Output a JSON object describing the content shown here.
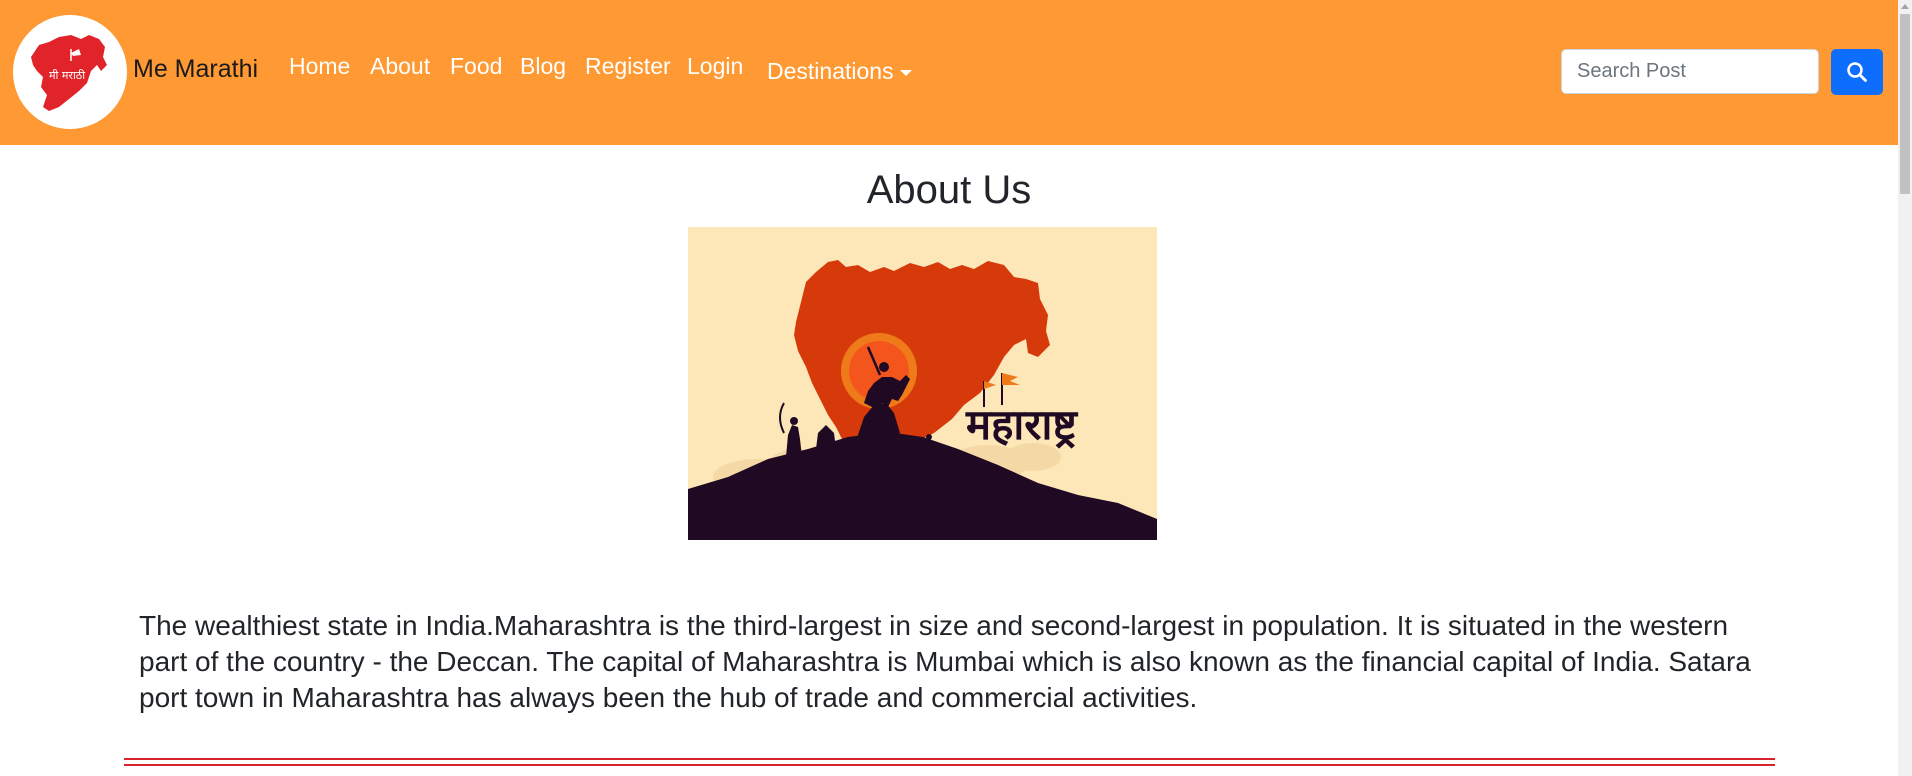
{
  "navbar": {
    "logo_text": "मी मराठी",
    "brand": "Me Marathi",
    "links": [
      "Home",
      "About",
      "Food",
      "Blog",
      "Register",
      "Login"
    ],
    "dropdown_label": "Destinations",
    "search": {
      "placeholder": "Search Post",
      "value": ""
    },
    "search_button_icon": "search-icon",
    "bg_color": "#ff9933",
    "button_color": "#0d6efd"
  },
  "main": {
    "title": "About Us",
    "image": {
      "caption_text": "महाराष्ट्र",
      "alt": "Maharashtra"
    },
    "paragraph": "The wealthiest state in India.Maharashtra is the third-largest in size and second-largest in population. It is situated in the western part of the country - the Deccan. The capital of Maharashtra is Mumbai which is also known as the financial capital of India. Satara port town in Maharashtra has always been the hub of trade and commercial activities.",
    "divider_color": "#d9232d"
  }
}
